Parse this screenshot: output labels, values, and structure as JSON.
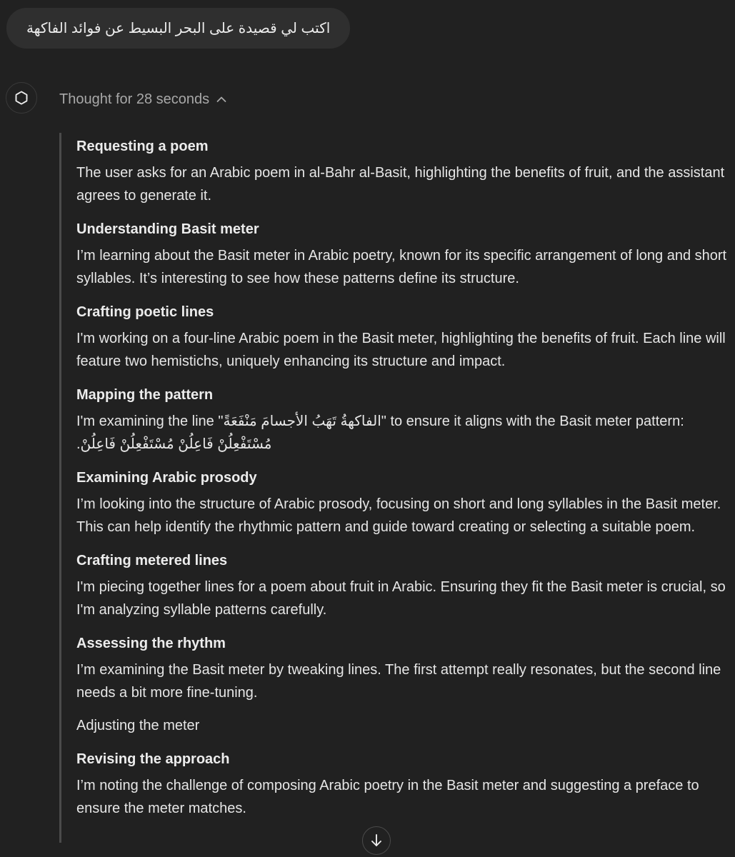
{
  "user_message": {
    "text": "اكتب لي قصيدة على البحر البسيط عن فوائد الفاكهة"
  },
  "assistant": {
    "avatar_icon": "openai-logo-icon",
    "thought_toggle": {
      "label": "Thought for 28 seconds",
      "icon": "chevron-up-icon"
    }
  },
  "reasoning_steps": [
    {
      "title": "Requesting a poem",
      "text": "The user asks for an Arabic poem in al-Bahr al-Basit, highlighting the benefits of fruit, and the assistant agrees to generate it."
    },
    {
      "title": "Understanding Basit meter",
      "text": "I’m learning about the Basit meter in Arabic poetry, known for its specific arrangement of long and short syllables. It’s interesting to see how these patterns define its structure."
    },
    {
      "title": "Crafting poetic lines",
      "text": "I'm working on a four-line Arabic poem in the Basit meter, highlighting the benefits of fruit. Each line will feature two hemistichs, uniquely enhancing its structure and impact."
    },
    {
      "title": "Mapping the pattern",
      "text_line1": "I'm examining the line \"الفاكهةُ تَهَبُ الأجسامَ مَنْفَعَةً\" to ensure it aligns with the Basit meter pattern:",
      "text_line2": "مُسْتَفْعِلُنْ فَاعِلُنْ مُسْتَفْعِلُنْ فَاعِلُنْ."
    },
    {
      "title": "Examining Arabic prosody",
      "text": "I’m looking into the structure of Arabic prosody, focusing on short and long syllables in the Basit meter. This can help identify the rhythmic pattern and guide toward creating or selecting a suitable poem."
    },
    {
      "title": "Crafting metered lines",
      "text": "I'm piecing together lines for a poem about fruit in Arabic. Ensuring they fit the Basit meter is crucial, so I'm analyzing syllable patterns carefully."
    },
    {
      "title": "Assessing the rhythm",
      "text": "I’m examining the Basit meter by tweaking lines. The first attempt really resonates, but the second line needs a bit more fine-tuning."
    },
    {
      "plain": "Adjusting the meter"
    },
    {
      "title": "Revising the approach",
      "text": "I’m noting the challenge of composing Arabic poetry in the Basit meter and suggesting a preface to ensure the meter matches."
    }
  ],
  "scroll_button": {
    "icon": "arrow-down-icon"
  }
}
